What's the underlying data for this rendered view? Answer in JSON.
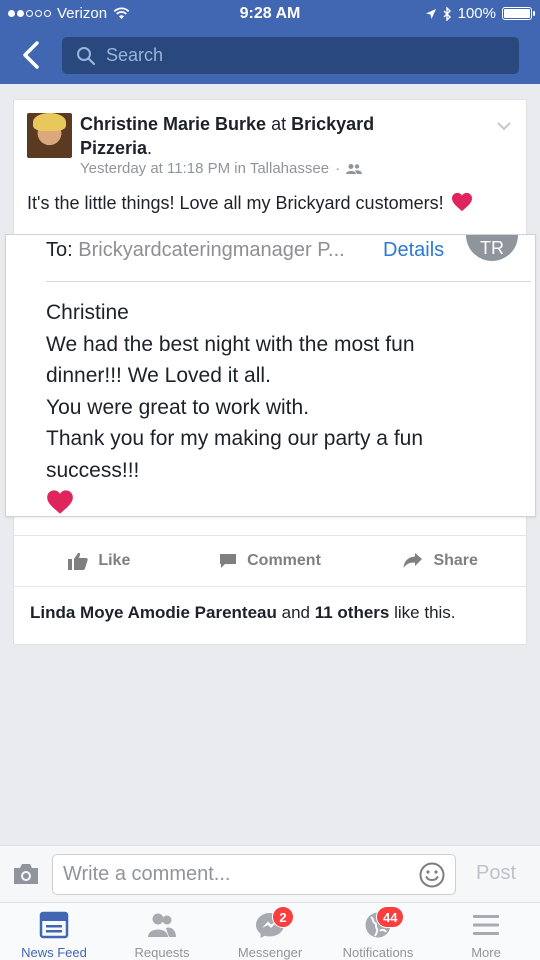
{
  "status_bar": {
    "carrier": "Verizon",
    "time": "9:28 AM",
    "battery": "100%",
    "signal_dots_filled": 2,
    "signal_dots_total": 5
  },
  "nav": {
    "search_placeholder": "Search"
  },
  "post": {
    "author": "Christine Marie Burke",
    "at_word": "at",
    "place": "Brickyard Pizzeria",
    "period": ".",
    "timestamp": "Yesterday at 11:18 PM in Tallahassee",
    "separator": "·",
    "text": "It's the little things! Love all my Brickyard customers!",
    "embedded_message": {
      "to_label": "To:",
      "to_address": "Brickyardcateringmanager P...",
      "details_link": "Details",
      "avatar_initials": "TR",
      "lines": [
        "Christine",
        "We had the best night with the most fun",
        "dinner!!! We Loved it all.",
        "You were great to work with.",
        "Thank you for my making our party a fun",
        "success!!!"
      ]
    },
    "actions": {
      "like": "Like",
      "comment": "Comment",
      "share": "Share"
    },
    "likes": {
      "names": "Linda Moye Amodie Parenteau",
      "and_word": "and",
      "others": "11 others",
      "suffix": "like this."
    }
  },
  "comment_bar": {
    "placeholder": "Write a comment...",
    "post_label": "Post"
  },
  "tabs": [
    {
      "label": "News Feed",
      "icon": "news-feed-icon",
      "active": true
    },
    {
      "label": "Requests",
      "icon": "requests-icon"
    },
    {
      "label": "Messenger",
      "icon": "messenger-icon",
      "badge": "2"
    },
    {
      "label": "Notifications",
      "icon": "globe-icon",
      "badge": "44"
    },
    {
      "label": "More",
      "icon": "menu-icon"
    }
  ],
  "colors": {
    "brand": "#4267b2",
    "link": "#2a7ad6",
    "badge": "#fa3e3e",
    "heart": "#e0245e"
  }
}
